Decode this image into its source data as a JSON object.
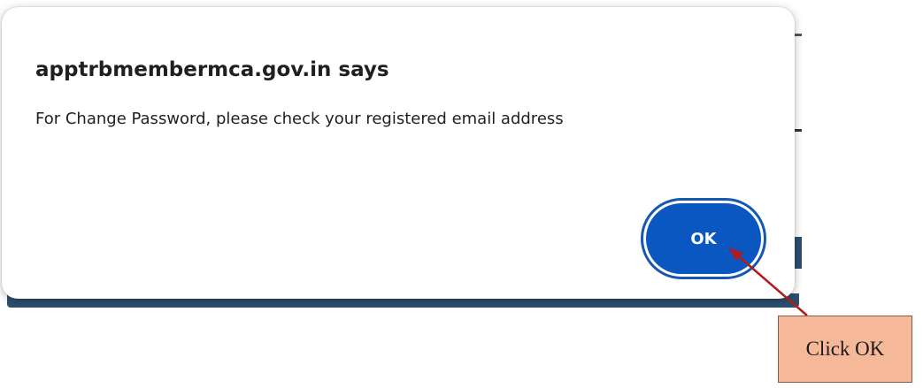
{
  "dialog": {
    "title": "apptrbmembermca.gov.in says",
    "message": "For Change Password, please check your registered email address",
    "ok_label": "OK"
  },
  "annotation": {
    "label": "Click OK",
    "arrow_color": "#b01c1c",
    "box_color": "#f5b99a"
  },
  "colors": {
    "button": "#0b57c2",
    "page_bar": "#2b4f6e"
  }
}
